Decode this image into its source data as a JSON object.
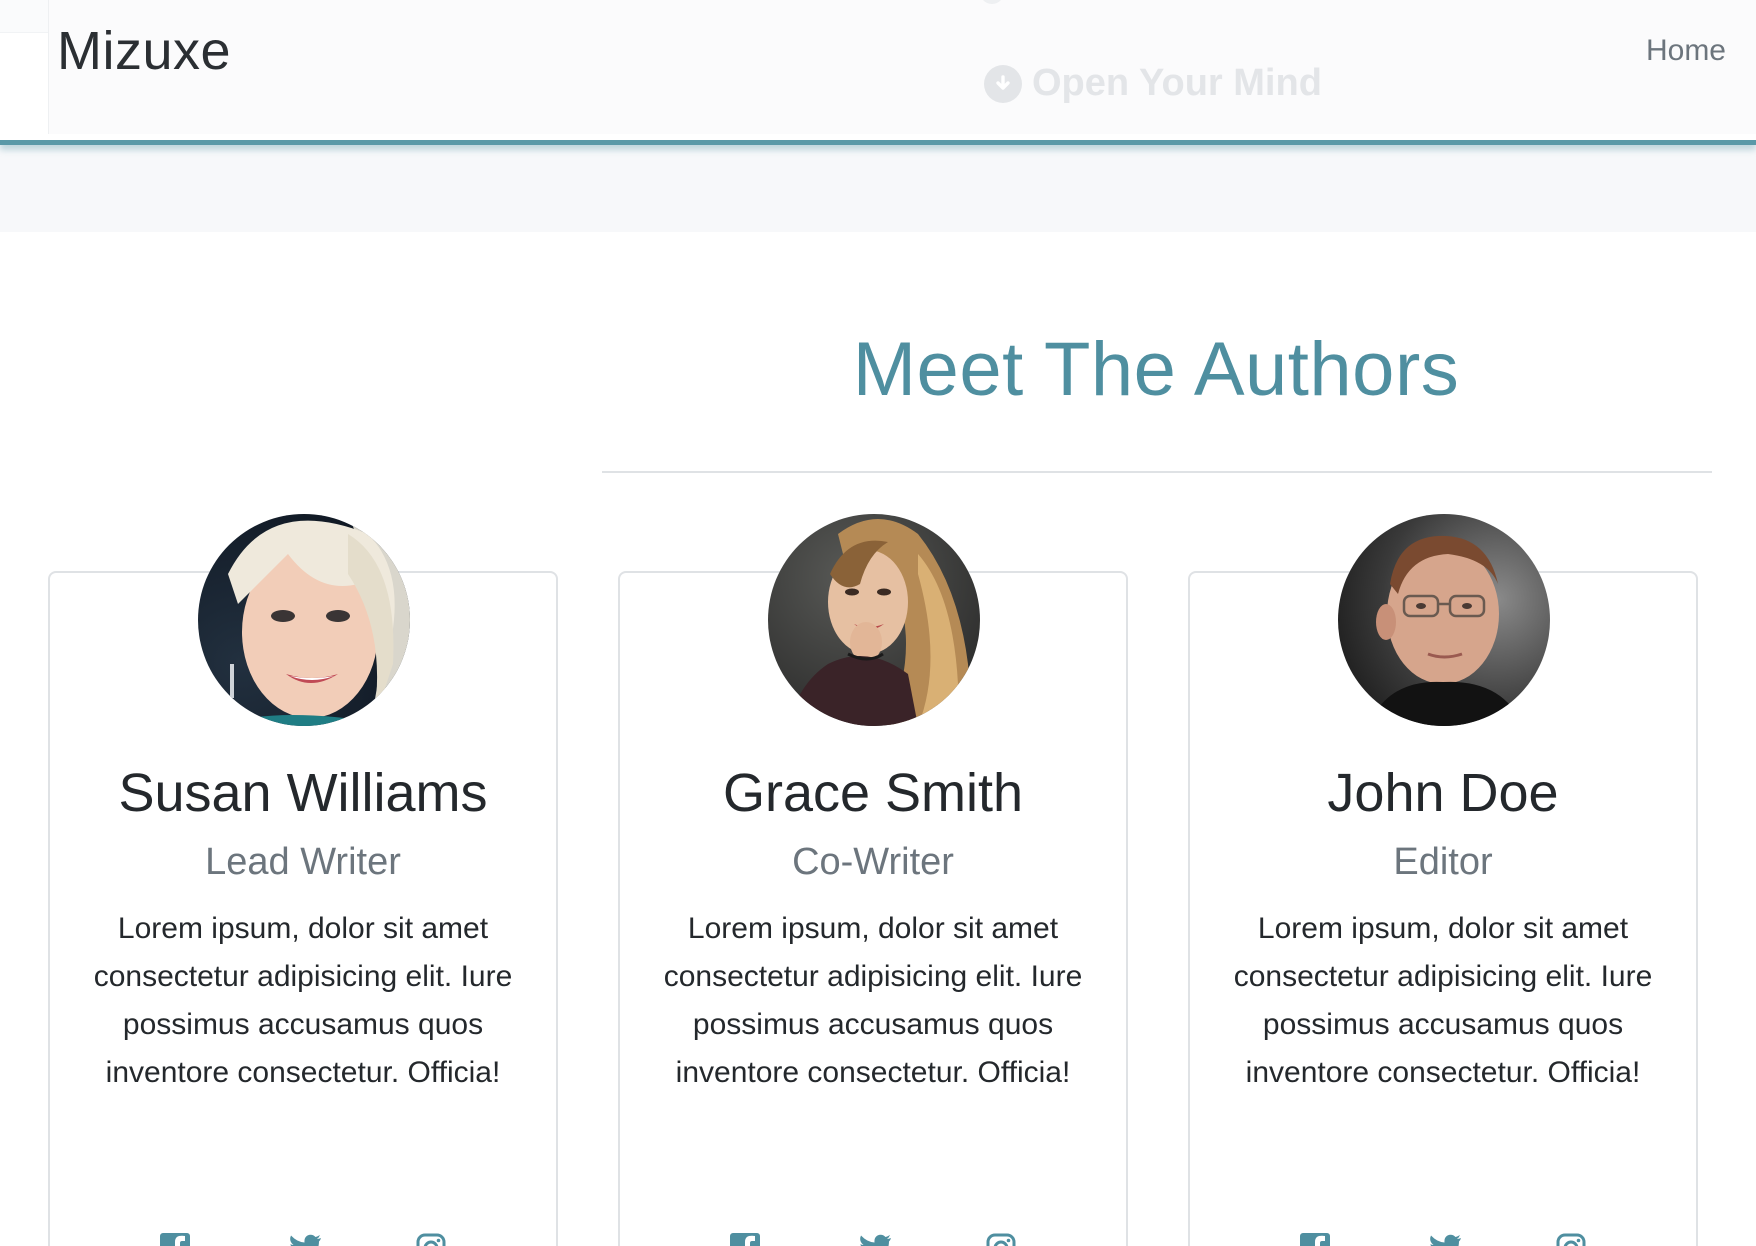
{
  "nav": {
    "brand": "Mizuxe",
    "links": [
      {
        "label": "Home"
      }
    ],
    "background_banner_text": "Open Your Mind"
  },
  "section": {
    "title": "Meet The Authors"
  },
  "authors": [
    {
      "name": "Susan Williams",
      "role": "Lead Writer",
      "bio": "Lorem ipsum, dolor sit amet consectetur adipisicing elit. Iure possimus accusamus quos inventore consectetur. Officia!",
      "photo": "portrait-woman-blonde-short-hair",
      "social": [
        "facebook-icon",
        "twitter-icon",
        "instagram-icon"
      ]
    },
    {
      "name": "Grace Smith",
      "role": "Co-Writer",
      "bio": "Lorem ipsum, dolor sit amet consectetur adipisicing elit. Iure possimus accusamus quos inventore consectetur. Officia!",
      "photo": "portrait-woman-long-hair",
      "social": [
        "facebook-icon",
        "twitter-icon",
        "instagram-icon"
      ]
    },
    {
      "name": "John Doe",
      "role": "Editor",
      "bio": "Lorem ipsum, dolor sit amet consectetur adipisicing elit. Iure possimus accusamus quos inventore consectetur. Officia!",
      "photo": "portrait-man-glasses",
      "social": [
        "facebook-icon",
        "twitter-icon",
        "instagram-icon"
      ]
    }
  ],
  "colors": {
    "accent": "#4f8fa0",
    "navbar_border": "#5a99a8",
    "muted_text": "#6c757d",
    "band": "#f7f8fa"
  }
}
